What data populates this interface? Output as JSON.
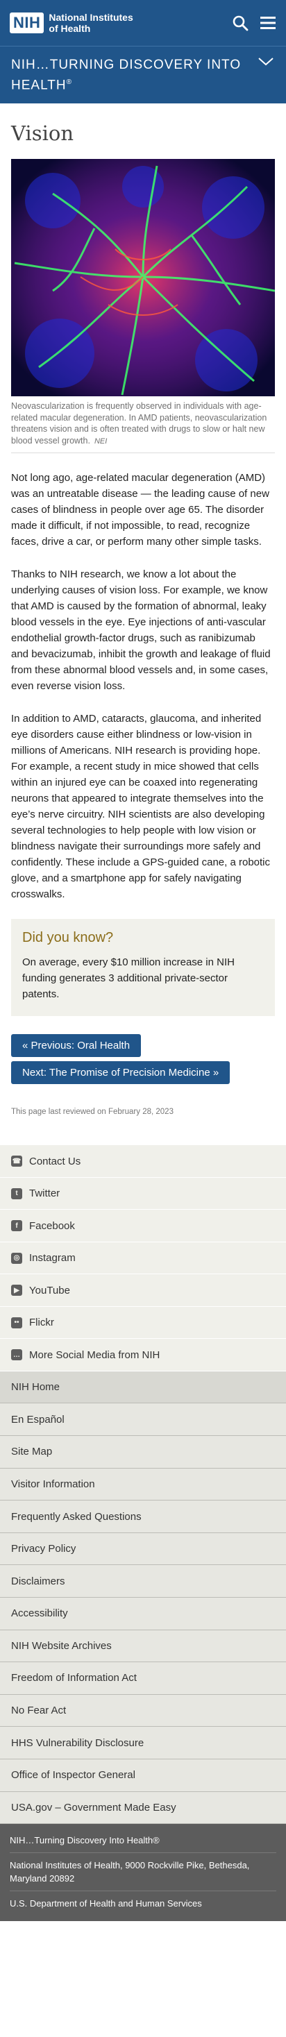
{
  "header": {
    "logo_abbr": "NIH",
    "logo_line1": "National Institutes",
    "logo_line2": "of Health"
  },
  "subheader": {
    "title": "NIH…TURNING DISCOVERY INTO HEALTH",
    "reg": "®"
  },
  "page": {
    "title": "Vision",
    "caption": "Neovascularization is frequently observed in individuals with age-related macular degeneration. In AMD patients, neovascularization threatens vision and is often treated with drugs to slow or halt new blood vessel growth.",
    "caption_credit": "NEI",
    "paragraphs": [
      "Not long ago, age-related macular degeneration (AMD) was an untreatable disease — the leading cause of new cases of blindness in people over age 65. The disorder made it difficult, if not impossible, to read, recognize faces, drive a car, or perform many other simple tasks.",
      "Thanks to NIH research, we know a lot about the underlying causes of vision loss. For example, we know that AMD is caused by the formation of abnormal, leaky blood vessels in the eye. Eye injections of anti-vascular endothelial growth-factor drugs, such as ranibizumab and bevacizumab, inhibit the growth and leakage of fluid from these abnormal blood vessels and, in some cases, even reverse vision loss.",
      "In addition to AMD, cataracts, glaucoma, and inherited eye disorders cause either blindness or low-vision in millions of Americans. NIH research is providing hope. For example, a recent study in mice showed that cells within an injured eye can be coaxed into regenerating neurons that appeared to integrate themselves into the eye’s nerve circuitry. NIH scientists are also developing several technologies to help people with low vision or blindness navigate their surroundings more safely and confidently. These include a GPS-guided cane, a robotic glove, and a smartphone app for safely navigating crosswalks."
    ],
    "did_you_know_title": "Did you know?",
    "did_you_know_text": "On average, every $10 million increase in NIH funding generates 3 additional private-sector patents.",
    "prev_label": "« Previous: Oral Health",
    "next_label": "Next: The Promise of Precision Medicine »",
    "reviewed": "This page last reviewed on February 28, 2023"
  },
  "social": [
    {
      "label": "Contact Us",
      "icon": "phone-icon",
      "glyph": "☎"
    },
    {
      "label": "Twitter",
      "icon": "twitter-icon",
      "glyph": "t"
    },
    {
      "label": "Facebook",
      "icon": "facebook-icon",
      "glyph": "f"
    },
    {
      "label": "Instagram",
      "icon": "instagram-icon",
      "glyph": "◎"
    },
    {
      "label": "YouTube",
      "icon": "youtube-icon",
      "glyph": "▶"
    },
    {
      "label": "Flickr",
      "icon": "flickr-icon",
      "glyph": "••"
    },
    {
      "label": "More Social Media from NIH",
      "icon": "chat-icon",
      "glyph": "…"
    }
  ],
  "footer_links": [
    "NIH Home",
    "En Español",
    "Site Map",
    "Visitor Information",
    "Frequently Asked Questions",
    "Privacy Policy",
    "Disclaimers",
    "Accessibility",
    "NIH Website Archives",
    "Freedom of Information Act",
    "No Fear Act",
    "HHS Vulnerability Disclosure",
    "Office of Inspector General",
    "USA.gov – Government Made Easy"
  ],
  "bottom": {
    "tagline": "NIH…Turning Discovery Into Health®",
    "address": "National Institutes of Health, 9000 Rockville Pike, Bethesda, Maryland 20892",
    "hhs": "U.S. Department of Health and Human Services"
  },
  "colors": {
    "brand_blue": "#20558a",
    "did_you_know_gold": "#8b6d1a"
  }
}
